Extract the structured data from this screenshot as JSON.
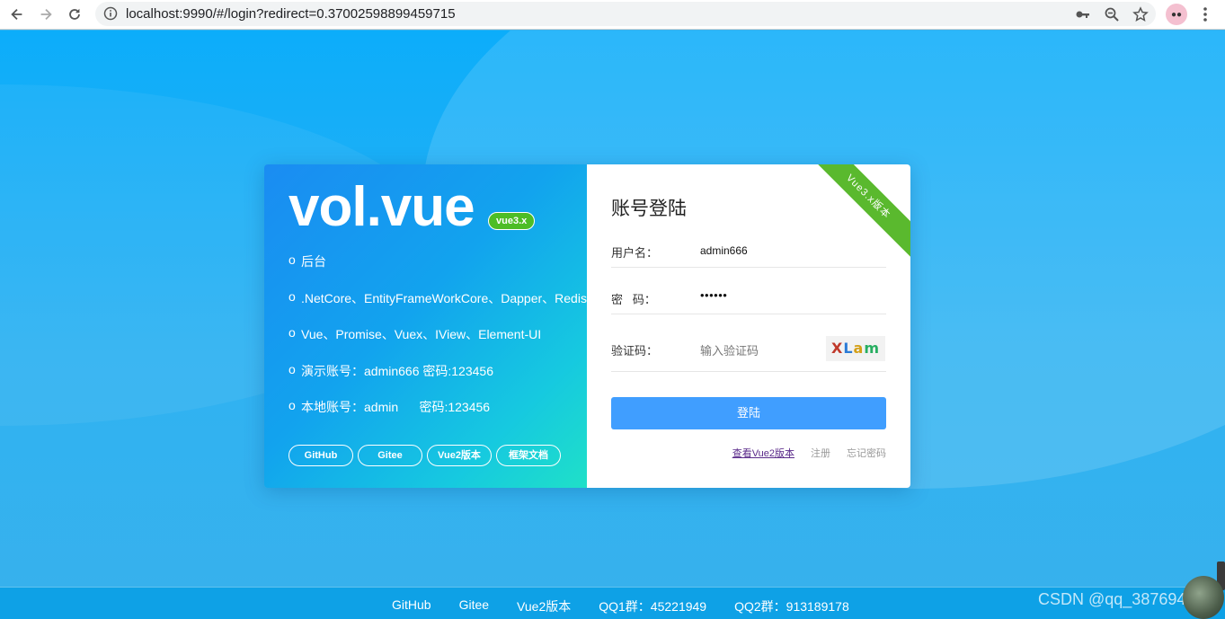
{
  "browser": {
    "url": "localhost:9990/#/login?redirect=0.37002598899459715",
    "icons": [
      "back-arrow-icon",
      "forward-arrow-icon",
      "reload-icon",
      "info-icon",
      "key-icon",
      "zoom-icon",
      "star-icon",
      "profile-avatar",
      "menu-dots-icon"
    ]
  },
  "left_panel": {
    "brand": "vol.vue",
    "badge": "vue3.x",
    "features": [
      {
        "bullet": "o",
        "text": "后台"
      },
      {
        "bullet": "o",
        "text": ".NetCore、EntityFrameWorkCore、Dapper、Redis"
      },
      {
        "bullet": "o",
        "text": "Vue、Promise、Vuex、IView、Element-UI"
      },
      {
        "bullet": "o",
        "text": "演示账号：admin666 密码:123456"
      },
      {
        "bullet": "o",
        "text": "本地账号：admin      密码:123456"
      }
    ],
    "links": [
      "GitHub",
      "Gitee",
      "Vue2版本",
      "框架文档"
    ]
  },
  "login_form": {
    "ribbon": "Vue3.x版本",
    "title": "账号登陆",
    "username_label": "用户名：",
    "username_value": "admin666",
    "password_label": "密   码：",
    "password_value": "••••••",
    "captcha_label": "验证码：",
    "captcha_placeholder": "输入验证码",
    "captcha_chars": [
      "X",
      "L",
      "a",
      "m"
    ],
    "submit_label": "登陆",
    "links": {
      "vue2": "查看Vue2版本",
      "register": "注册",
      "forgot": "忘记密码"
    }
  },
  "footer": {
    "links": [
      "GitHub",
      "Gitee",
      "Vue2版本",
      "QQ1群：45221949",
      "QQ2群：913189178"
    ],
    "watermark": "CSDN @qq_38769403"
  },
  "colors": {
    "page_bg": "#2fb2f2",
    "login_button": "#409eff",
    "ribbon": "#5ab92e",
    "badge": "#4dbd26"
  }
}
